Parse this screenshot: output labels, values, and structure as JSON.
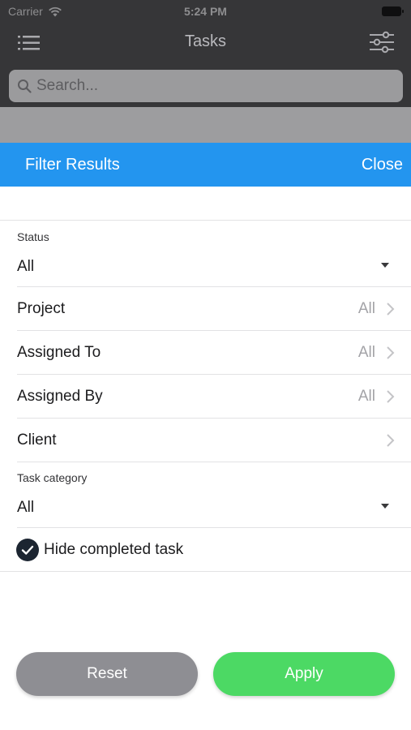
{
  "status_bar": {
    "carrier": "Carrier",
    "time": "5:24 PM"
  },
  "nav": {
    "title": "Tasks"
  },
  "search": {
    "placeholder": "Search..."
  },
  "sheet": {
    "title": "Filter Results",
    "close_label": "Close",
    "status": {
      "caption": "Status",
      "value": "All"
    },
    "rows": [
      {
        "label": "Project",
        "value": "All"
      },
      {
        "label": "Assigned To",
        "value": "All"
      },
      {
        "label": "Assigned By",
        "value": "All"
      },
      {
        "label": "Client",
        "value": ""
      }
    ],
    "task_category": {
      "caption": "Task category",
      "value": "All"
    },
    "hide_completed": {
      "label": "Hide completed task",
      "checked": true
    }
  },
  "actions": {
    "reset_label": "Reset",
    "apply_label": "Apply"
  },
  "colors": {
    "header_blue": "#2395ef",
    "apply_green": "#4cd964",
    "reset_gray": "#8e8e93",
    "nav_dark": "#363638"
  },
  "icons": [
    "wifi-icon",
    "battery-icon",
    "menu-icon",
    "filter-sliders-icon",
    "search-icon",
    "chevron-right-icon",
    "dropdown-arrow-icon",
    "checkmark-icon"
  ]
}
